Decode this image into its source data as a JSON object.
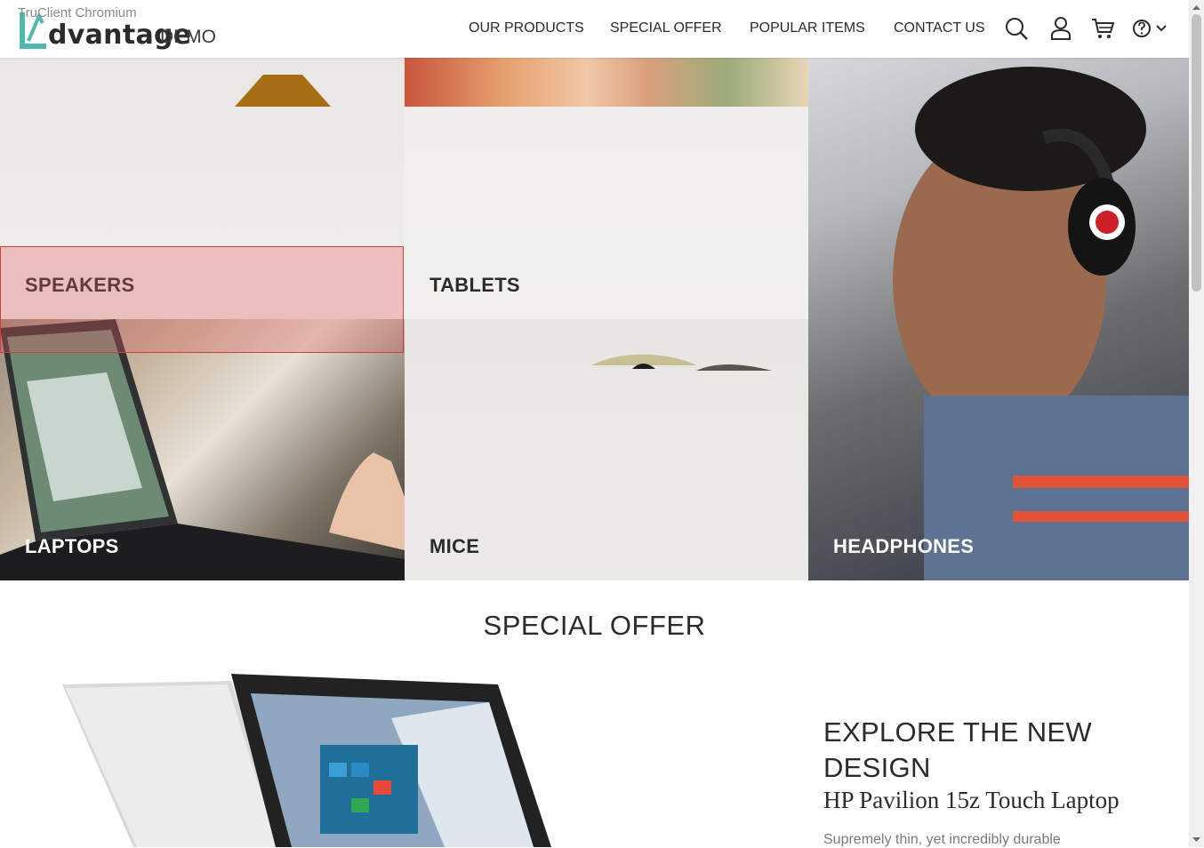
{
  "browser": {
    "label": "TruClient Chromium"
  },
  "logo": {
    "word": "dvantage",
    "suffix": "DEMO"
  },
  "nav": {
    "items": [
      "OUR PRODUCTS",
      "SPECIAL OFFER",
      "POPULAR ITEMS",
      "CONTACT US"
    ]
  },
  "header_icons": [
    "search-icon",
    "user-icon",
    "cart-icon",
    "help-icon",
    "chevron-down-icon"
  ],
  "categories": {
    "speakers": "SPEAKERS",
    "tablets": "TABLETS",
    "laptops": "LAPTOPS",
    "mice": "MICE",
    "headphones": "HEADPHONES"
  },
  "special_offer": {
    "title": "SPECIAL OFFER",
    "heading": "EXPLORE THE NEW DESIGN",
    "product": "HP Pavilion 15z Touch Laptop",
    "description": "Supremely thin, yet incredibly durable"
  },
  "colors": {
    "brand_teal": "#4fb9b0",
    "highlight": "#d33c3c",
    "text": "#2b2b2b"
  }
}
